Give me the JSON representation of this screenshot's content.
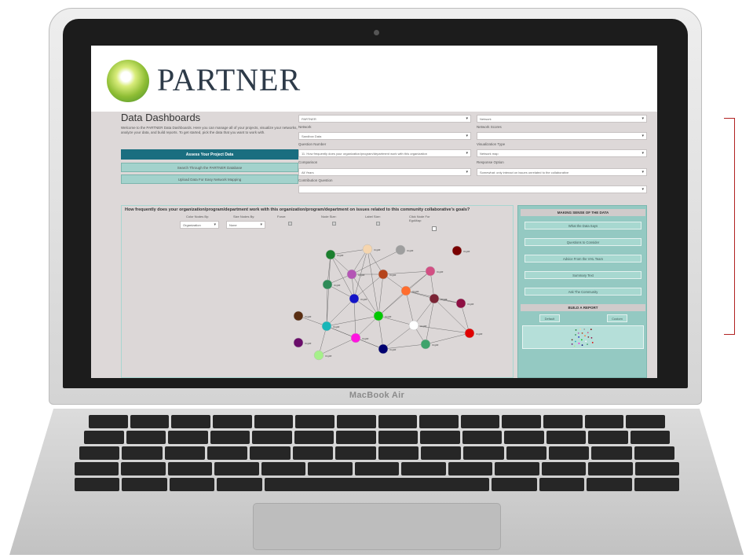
{
  "device": {
    "brand": "MacBook Air"
  },
  "app": {
    "logo_text": "PARTNER"
  },
  "dashboard": {
    "title": "Data Dashboards",
    "welcome_text": "Welcome to the PARTNER Data Dashboards. Here you can manage all of your projects, visualize your networks, analyze your data, and build reports. To get started, pick the data that you want to work with.",
    "buttons": {
      "assess": "Assess Your Project Data",
      "search": "Search Through the PARTNER Database",
      "upload": "Upload Data For Easy Network Mapping"
    }
  },
  "filters": {
    "project": {
      "value": "PARTNER"
    },
    "view": {
      "value": "Network"
    },
    "network": {
      "label": "Network",
      "value": "Sandbox Data"
    },
    "network_scores": {
      "label": "Network Scores",
      "value": ""
    },
    "question_number": {
      "label": "Question Number",
      "value": "11. How frequently does your organization/program/department work with this organization"
    },
    "visualization_type": {
      "label": "Visualization Type",
      "value": "Network map"
    },
    "comparison": {
      "label": "Comparison",
      "value": "All Years"
    },
    "response_option": {
      "label": "Response Option",
      "value": "Somewhat: only interact on issues unrelated to the collaborative"
    },
    "contribution_question": {
      "label": "Contribution Question",
      "value": ""
    }
  },
  "network_panel": {
    "question": "How frequently does your organization/program/department work with this organization/program/department on issues related to this community collaborative's goals?",
    "controls": {
      "color_nodes_by": {
        "label": "Color Nodes By:",
        "value": "Organization"
      },
      "size_nodes_by": {
        "label": "Size Nodes By:",
        "value": "None"
      },
      "force": {
        "label": "Force:"
      },
      "node_size": {
        "label": "Node Size:"
      },
      "label_size": {
        "label": "Label Size:"
      },
      "click_node": {
        "label": "Click Node For EgoMap:"
      }
    },
    "node_label": "Org##"
  },
  "side_panel": {
    "making_sense_header": "MAKING SENSE OF THE DATA",
    "buttons": {
      "what_data_says": "What the Data Says",
      "questions": "Questions to Consider",
      "advice": "Advice From the VHL Team",
      "summary": "Summary Text",
      "ask": "Ask The Community"
    },
    "build_report_header": "BUILD A REPORT",
    "default_label": "Default",
    "custom_label": "Custom"
  },
  "node_colors": [
    "#1b7f2e",
    "#f5d5ae",
    "#9e9e9e",
    "#7a0000",
    "#2e8b57",
    "#b455b5",
    "#b5441c",
    "#d24f83",
    "#ff6d2e",
    "#7b2435",
    "#8e0f43",
    "#1414c8",
    "#00c800",
    "#5a2e12",
    "#18b6b8",
    "#ffffff",
    "#e00000",
    "#6a0d6a",
    "#ff14e0",
    "#000070",
    "#3ea36b",
    "#a6f08a"
  ]
}
